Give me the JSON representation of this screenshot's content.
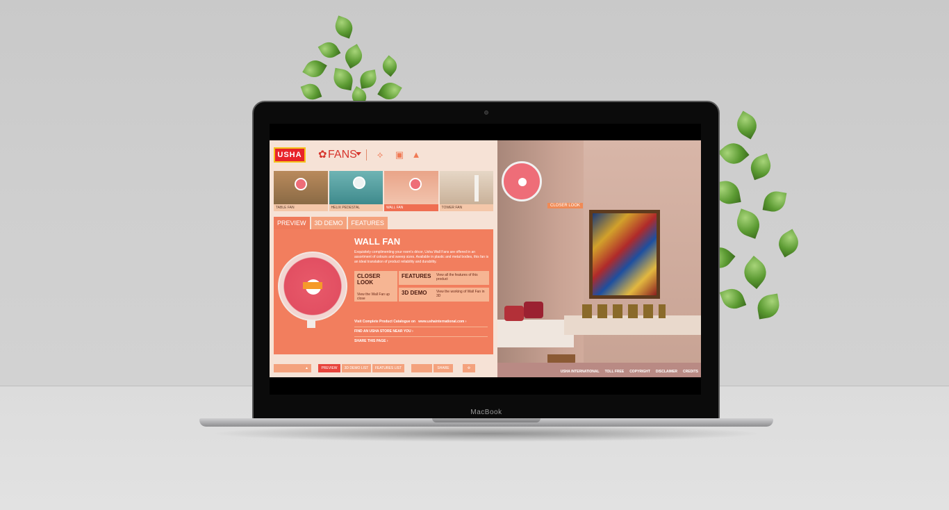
{
  "device": {
    "brand_label": "MacBook"
  },
  "site": {
    "logo_text": "USHA",
    "section_title": "FANS",
    "category_icons": [
      "ceiling-fan-icon",
      "table-fan-icon",
      "exhaust-fan-icon"
    ],
    "thumbnails": [
      {
        "label": "TABLE FAN",
        "active": false
      },
      {
        "label": "HELIX PEDESTAL",
        "active": false
      },
      {
        "label": "WALL FAN",
        "active": true
      },
      {
        "label": "TOWER FAN",
        "active": false
      }
    ],
    "tabs": [
      {
        "label": "PREVIEW",
        "active": true
      },
      {
        "label": "3D DEMO",
        "active": false
      },
      {
        "label": "FEATURES",
        "active": false
      }
    ],
    "product": {
      "title": "WALL FAN",
      "description": "Exquisitely complimenting your room's décor, Usha Wall Fans are offered in an assortment of colours and sweep sizes. Available in plastic and metal bodies, this fan is an ideal translation of product reliability and durability."
    },
    "action_boxes": [
      {
        "heading": "CLOSER LOOK",
        "text": "View the Wall Fan up close"
      },
      {
        "heading": "FEATURES",
        "text": "View all the features of this product"
      },
      {
        "heading": "3D DEMO",
        "text": "View the working of Wall Fan in 3D"
      }
    ],
    "links": {
      "catalogue_prefix": "Visit Complete Product Catalogue on",
      "catalogue_url": "www.ushainternational.com",
      "store": "FIND AN USHA STORE NEAR YOU",
      "share": "SHARE THIS PAGE"
    },
    "bottom_bar": {
      "preview": "PREVIEW",
      "demo_list": "3D DEMO LIST",
      "features_list": "FEATURES LIST",
      "share": "SHARE"
    },
    "scene": {
      "closer_look_tag": "CLOSER LOOK"
    },
    "footer_links": [
      "USHA INTERNATIONAL",
      "TOLL FREE",
      "COPYRIGHT",
      "DISCLAIMER",
      "CREDITS"
    ]
  }
}
